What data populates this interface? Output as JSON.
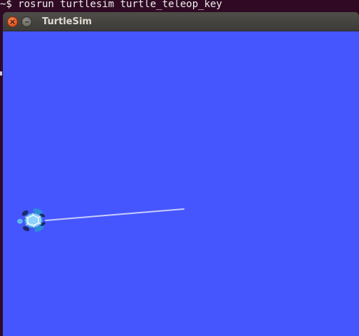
{
  "terminal": {
    "command_line": "~$ rosrun turtlesim turtle_teleop_key"
  },
  "window": {
    "title": "TurtleSim",
    "close_glyph": "×",
    "minimize_glyph": "–"
  },
  "canvas": {
    "background_color": "#4556ff",
    "trail_color": "#c8ccff"
  }
}
